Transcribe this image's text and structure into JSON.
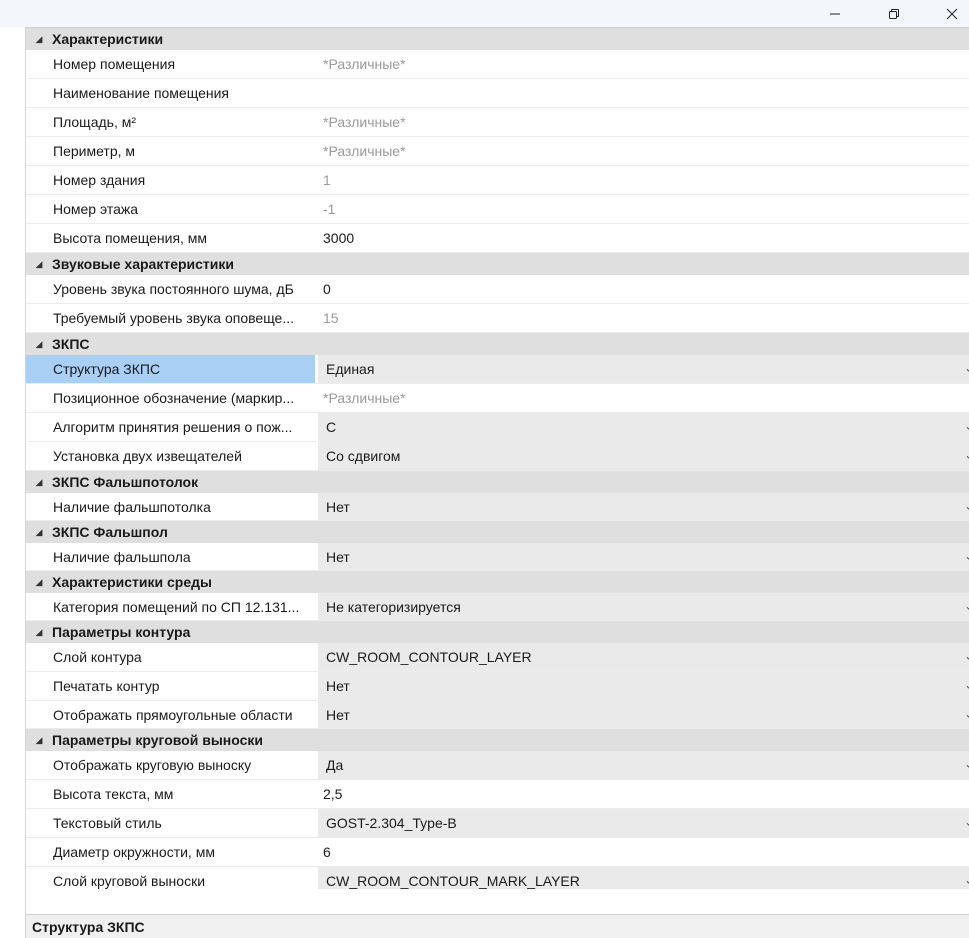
{
  "window": {
    "minimize_icon": "minimize-icon",
    "restore_icon": "restore-icon",
    "close_icon": "close-icon"
  },
  "categories": [
    {
      "label": "Характеристики",
      "rows": [
        {
          "name": "Номер помещения",
          "value": "*Различные*",
          "muted": true,
          "dropdown": false,
          "height": 29
        },
        {
          "name": "Наименование помещения",
          "value": "",
          "muted": false,
          "dropdown": false,
          "height": 29
        },
        {
          "name": "Площадь, м²",
          "value": "*Различные*",
          "muted": true,
          "dropdown": false,
          "height": 29
        },
        {
          "name": "Периметр, м",
          "value": "*Различные*",
          "muted": true,
          "dropdown": false,
          "height": 29
        },
        {
          "name": "Номер здания",
          "value": "1",
          "muted": true,
          "dropdown": false,
          "height": 29
        },
        {
          "name": "Номер этажа",
          "value": "-1",
          "muted": true,
          "dropdown": false,
          "height": 29
        },
        {
          "name": "Высота помещения, мм",
          "value": "3000",
          "muted": false,
          "dropdown": false,
          "height": 29
        }
      ]
    },
    {
      "label": "Звуковые характеристики",
      "rows": [
        {
          "name": "Уровень звука постоянного шума, дБ",
          "value": "0",
          "muted": false,
          "dropdown": false,
          "height": 29
        },
        {
          "name": "Требуемый уровень звука оповеще...",
          "value": "15",
          "muted": true,
          "dropdown": false,
          "height": 29
        }
      ]
    },
    {
      "label": "ЗКПС",
      "rows": [
        {
          "name": "Структура ЗКПС",
          "value": "Единая",
          "muted": false,
          "dropdown": true,
          "selected": true,
          "height": 29
        },
        {
          "name": "Позиционное обозначение (маркир...",
          "value": "*Различные*",
          "muted": true,
          "dropdown": false,
          "height": 29
        },
        {
          "name": "Алгоритм принятия решения о пож...",
          "value": "С",
          "muted": false,
          "dropdown": true,
          "height": 29
        },
        {
          "name": "Установка двух извещателей",
          "value": "Со сдвигом",
          "muted": false,
          "dropdown": true,
          "height": 29
        }
      ]
    },
    {
      "label": "ЗКПС Фальшпотолок",
      "rows": [
        {
          "name": "Наличие фальшпотолка",
          "value": "Нет",
          "muted": false,
          "dropdown": true,
          "height": 28
        }
      ]
    },
    {
      "label": "ЗКПС Фальшпол",
      "rows": [
        {
          "name": "Наличие фальшпола",
          "value": "Нет",
          "muted": false,
          "dropdown": true,
          "height": 28
        }
      ]
    },
    {
      "label": "Характеристики среды",
      "rows": [
        {
          "name": "Категория помещений по СП 12.131...",
          "value": "Не категоризируется",
          "muted": false,
          "dropdown": true,
          "height": 28
        }
      ]
    },
    {
      "label": "Параметры контура",
      "rows": [
        {
          "name": "Слой контура",
          "value": "CW_ROOM_CONTOUR_LAYER",
          "muted": false,
          "dropdown": true,
          "height": 29
        },
        {
          "name": "Печатать контур",
          "value": "Нет",
          "muted": false,
          "dropdown": true,
          "height": 29
        },
        {
          "name": "Отображать прямоугольные области",
          "value": "Нет",
          "muted": false,
          "dropdown": true,
          "height": 28
        }
      ]
    },
    {
      "label": "Параметры круговой выноски",
      "rows": [
        {
          "name": "Отображать круговую выноску",
          "value": "Да",
          "muted": false,
          "dropdown": true,
          "height": 29
        },
        {
          "name": "Высота текста, мм",
          "value": "2,5",
          "muted": false,
          "dropdown": false,
          "height": 29
        },
        {
          "name": "Текстовый стиль",
          "value": "GOST-2.304_Type-B",
          "muted": false,
          "dropdown": true,
          "height": 29
        },
        {
          "name": "Диаметр окружности, мм",
          "value": "6",
          "muted": false,
          "dropdown": false,
          "height": 29
        },
        {
          "name": "Слой круговой выноски",
          "value": "CW_ROOM_CONTOUR_MARK_LAYER",
          "muted": false,
          "dropdown": true,
          "height": 29
        }
      ]
    }
  ],
  "description": {
    "title": "Структура ЗКПС"
  },
  "colors": {
    "category_bg": "#dfdfdf",
    "selected_bg": "#a9cff5",
    "dropdown_bg": "#eaeaea",
    "muted_text": "#9a9a9a"
  }
}
